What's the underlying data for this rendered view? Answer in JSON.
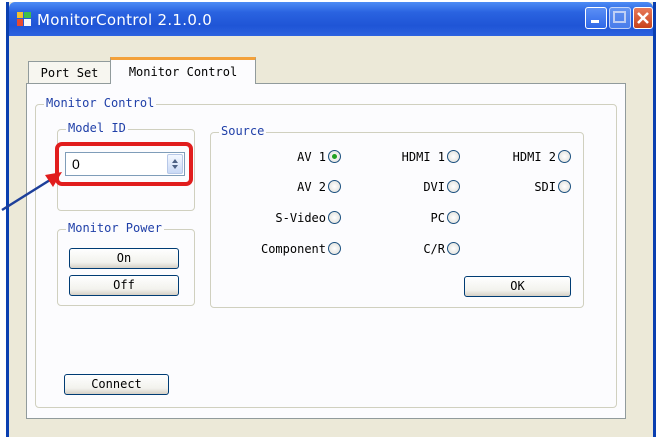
{
  "window": {
    "title": "MonitorControl  2.1.0.0"
  },
  "tabs": [
    {
      "label": "Port Set"
    },
    {
      "label": "Monitor Control"
    }
  ],
  "monitor_control": {
    "group_label": "Monitor Control",
    "model_id": {
      "label": "Model ID",
      "value": "0"
    },
    "power": {
      "label": "Monitor Power",
      "on_label": "On",
      "off_label": "Off"
    },
    "source": {
      "label": "Source",
      "options": [
        {
          "label": "AV 1",
          "selected": true
        },
        {
          "label": "HDMI 1",
          "selected": false
        },
        {
          "label": "HDMI 2",
          "selected": false
        },
        {
          "label": "AV 2",
          "selected": false
        },
        {
          "label": "DVI",
          "selected": false
        },
        {
          "label": "SDI",
          "selected": false
        },
        {
          "label": "S-Video",
          "selected": false
        },
        {
          "label": "PC",
          "selected": false
        },
        {
          "label": "Component",
          "selected": false
        },
        {
          "label": "C/R",
          "selected": false
        }
      ],
      "ok_label": "OK"
    },
    "connect_label": "Connect"
  },
  "colors": {
    "title_bar": "#2a63e0",
    "highlight": "#e11d1d",
    "radio_selected": "#21a121"
  },
  "icons": [
    "app-icon",
    "minimize-icon",
    "maximize-icon",
    "close-icon",
    "spin-up-icon",
    "spin-down-icon",
    "pointer-arrow-icon"
  ]
}
